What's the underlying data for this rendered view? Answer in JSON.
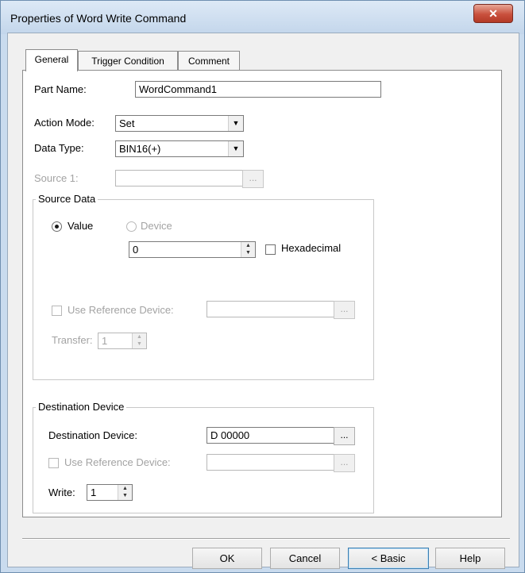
{
  "window": {
    "title": "Properties of Word Write Command",
    "close_glyph": "✕"
  },
  "tabs": [
    {
      "label": "General"
    },
    {
      "label": "Trigger Condition"
    },
    {
      "label": "Comment"
    }
  ],
  "general": {
    "part_name_label": "Part Name:",
    "part_name_value": "WordCommand1",
    "action_mode_label": "Action Mode:",
    "action_mode_value": "Set",
    "data_type_label": "Data Type:",
    "data_type_value": "BIN16(+)",
    "source1_label": "Source 1:",
    "source1_value": ""
  },
  "source_data": {
    "group_title": "Source Data",
    "value_option": "Value",
    "device_option": "Device",
    "value_field": "0",
    "hexadecimal_label": "Hexadecimal",
    "use_ref_label": "Use Reference Device:",
    "use_ref_value": "",
    "transfer_label": "Transfer:",
    "transfer_value": "1"
  },
  "destination": {
    "group_title": "Destination Device",
    "device_label": "Destination Device:",
    "device_value": "D 00000",
    "use_ref_label": "Use Reference Device:",
    "use_ref_value": "",
    "write_label": "Write:",
    "write_value": "1"
  },
  "buttons": {
    "ok": "OK",
    "cancel": "Cancel",
    "basic": "< Basic",
    "help": "Help",
    "ellipsis": "..."
  },
  "icons": [
    "close-icon",
    "dropdown-arrow-icon",
    "spin-up-icon",
    "spin-down-icon"
  ]
}
